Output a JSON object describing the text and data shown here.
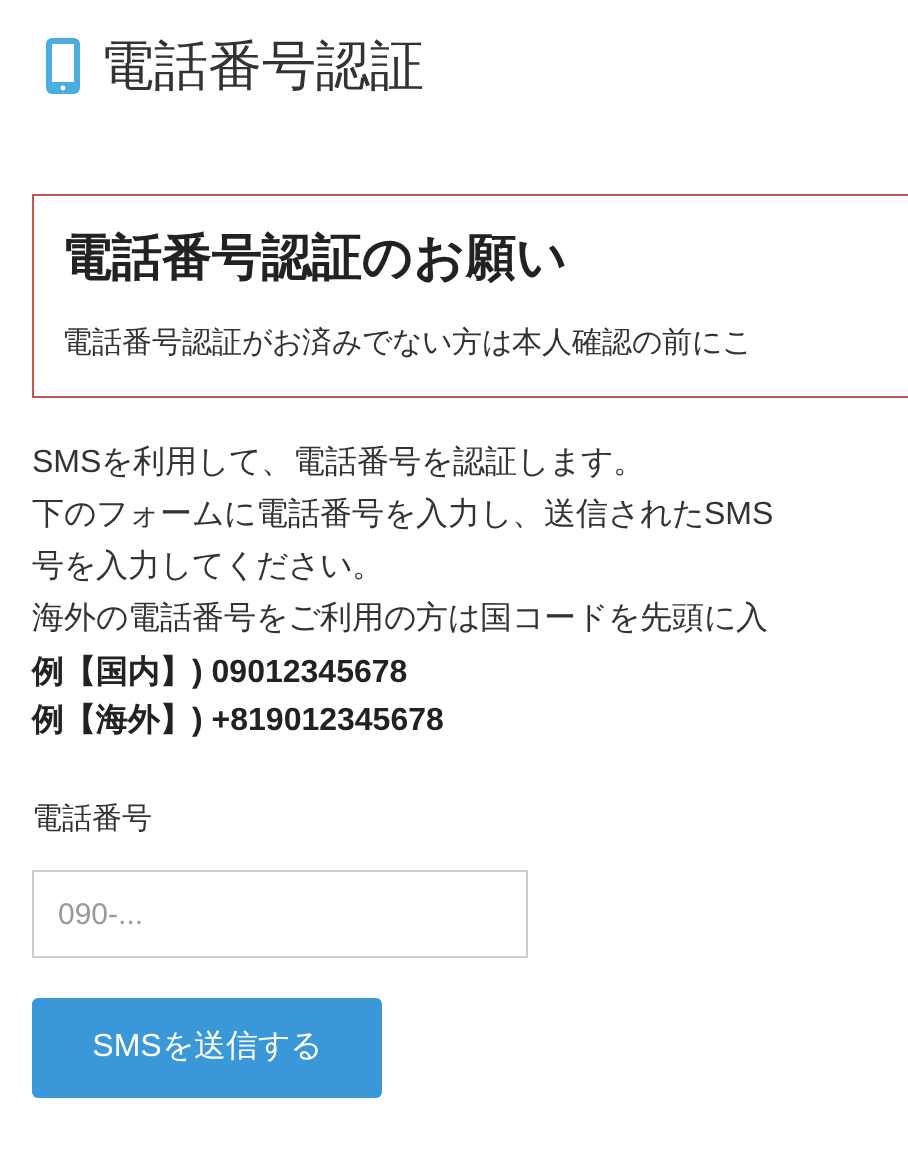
{
  "page_title": "電話番号認証",
  "notice": {
    "title": "電話番号認証のお願い",
    "text": "電話番号認証がお済みでない方は本人確認の前にこ"
  },
  "description_lines": [
    "SMSを利用して、電話番号を認証します。",
    "下のフォームに電話番号を入力し、送信されたSMS",
    "号を入力してください。",
    "海外の電話番号をご利用の方は国コードを先頭に入"
  ],
  "examples": [
    "例【国内】) 09012345678",
    "例【海外】) +819012345678"
  ],
  "phone_field": {
    "label": "電話番号",
    "placeholder": "090-..."
  },
  "submit_button": "SMSを送信する"
}
